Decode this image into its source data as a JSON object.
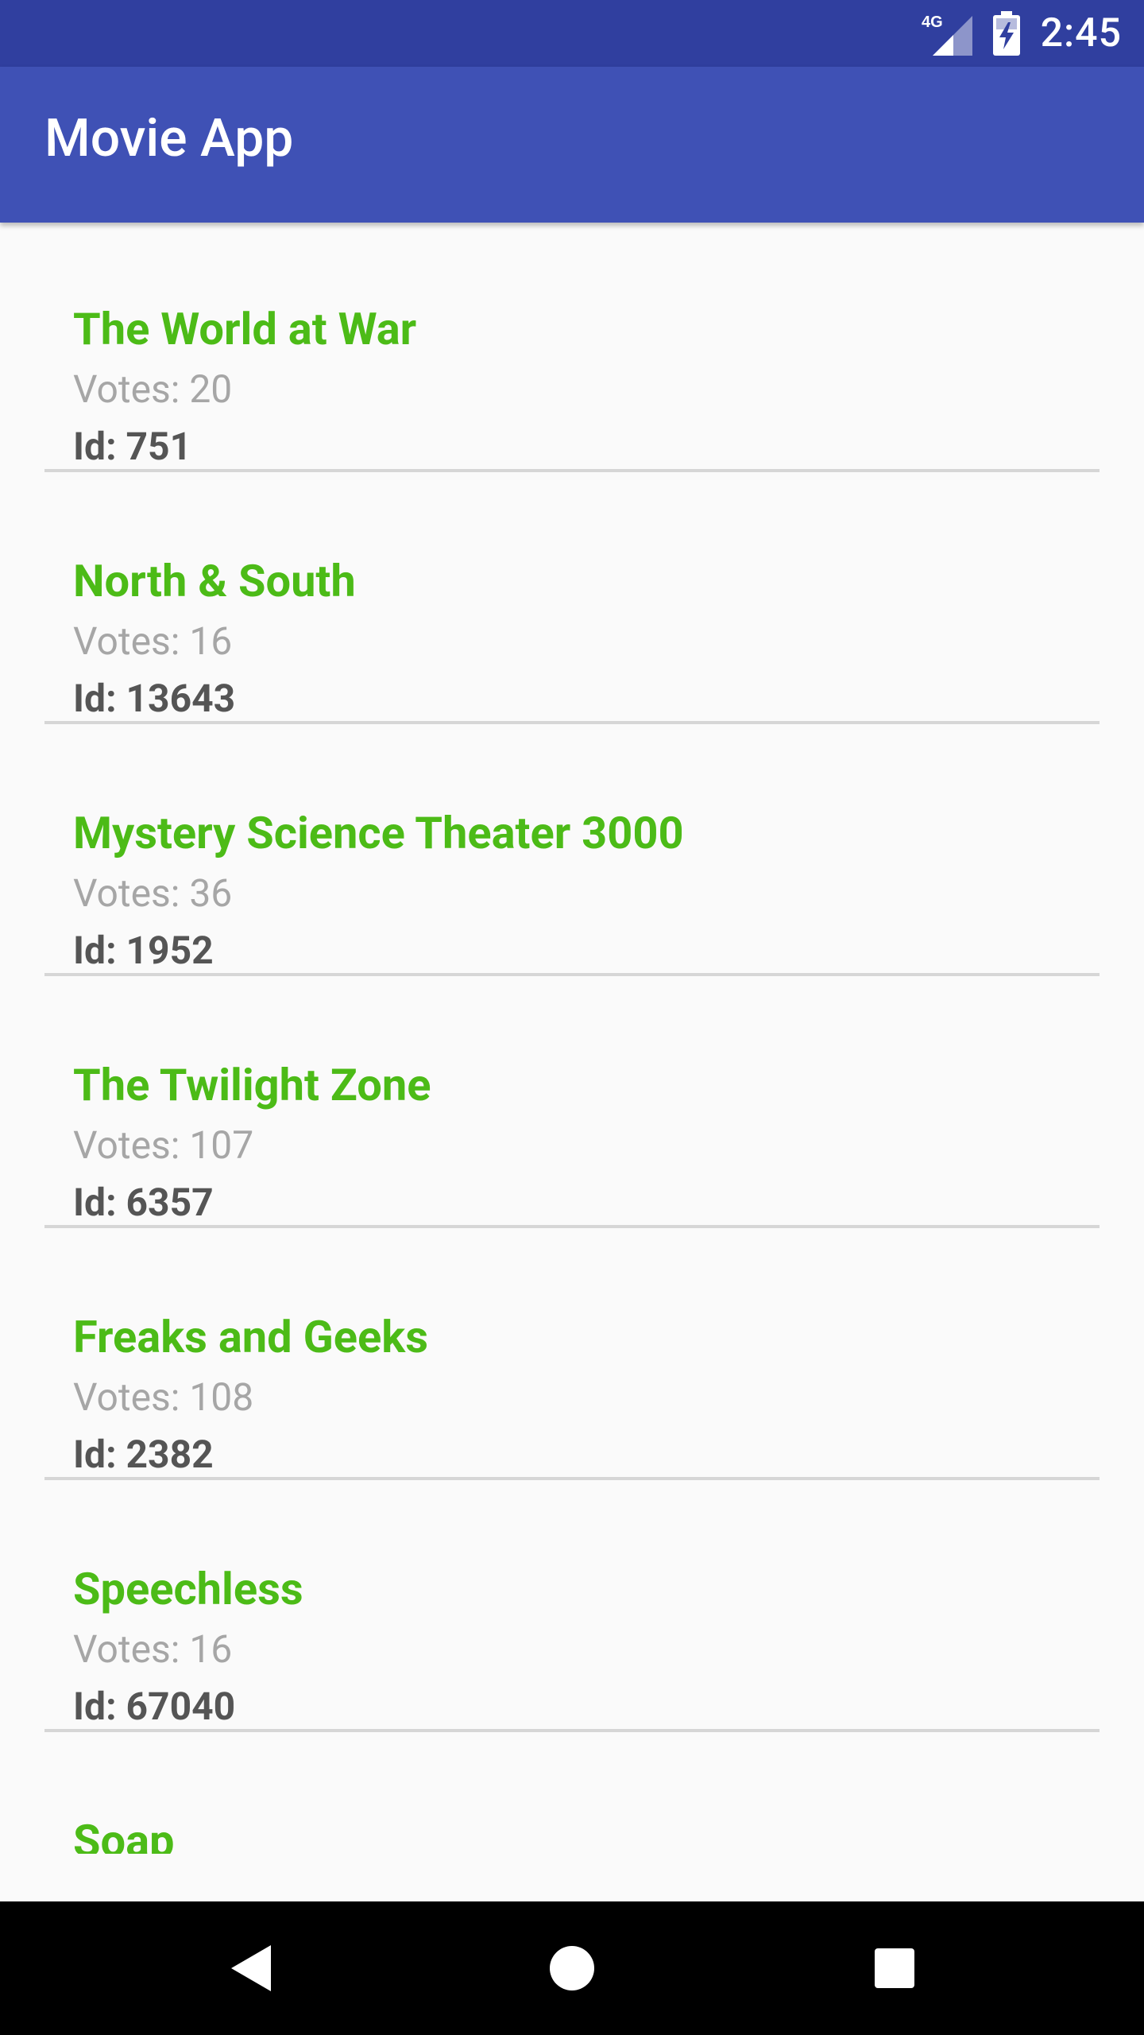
{
  "status_bar": {
    "network": "4G",
    "time": "2:45"
  },
  "app_bar": {
    "title": "Movie App"
  },
  "movies": [
    {
      "title": "The World at War",
      "votes": "Votes: 20",
      "id": "Id: 751"
    },
    {
      "title": "North & South",
      "votes": "Votes: 16",
      "id": "Id: 13643"
    },
    {
      "title": "Mystery Science Theater 3000",
      "votes": "Votes: 36",
      "id": "Id: 1952"
    },
    {
      "title": "The Twilight Zone",
      "votes": "Votes: 107",
      "id": "Id: 6357"
    },
    {
      "title": "Freaks and Geeks",
      "votes": "Votes: 108",
      "id": "Id: 2382"
    },
    {
      "title": "Speechless",
      "votes": "Votes: 16",
      "id": "Id: 67040"
    },
    {
      "title": "Soap",
      "votes": "",
      "id": ""
    }
  ],
  "nav_bar": {
    "back_icon": "back-triangle-icon",
    "home_icon": "home-circle-icon",
    "recents_icon": "recents-square-icon"
  },
  "colors": {
    "status_bar": "#303f9f",
    "app_bar": "#3f51b5",
    "title_green": "#4cbb17",
    "votes_gray": "#a6a6a6",
    "id_dark": "#555555",
    "divider": "#d6d6d6",
    "background": "#fafafa"
  }
}
